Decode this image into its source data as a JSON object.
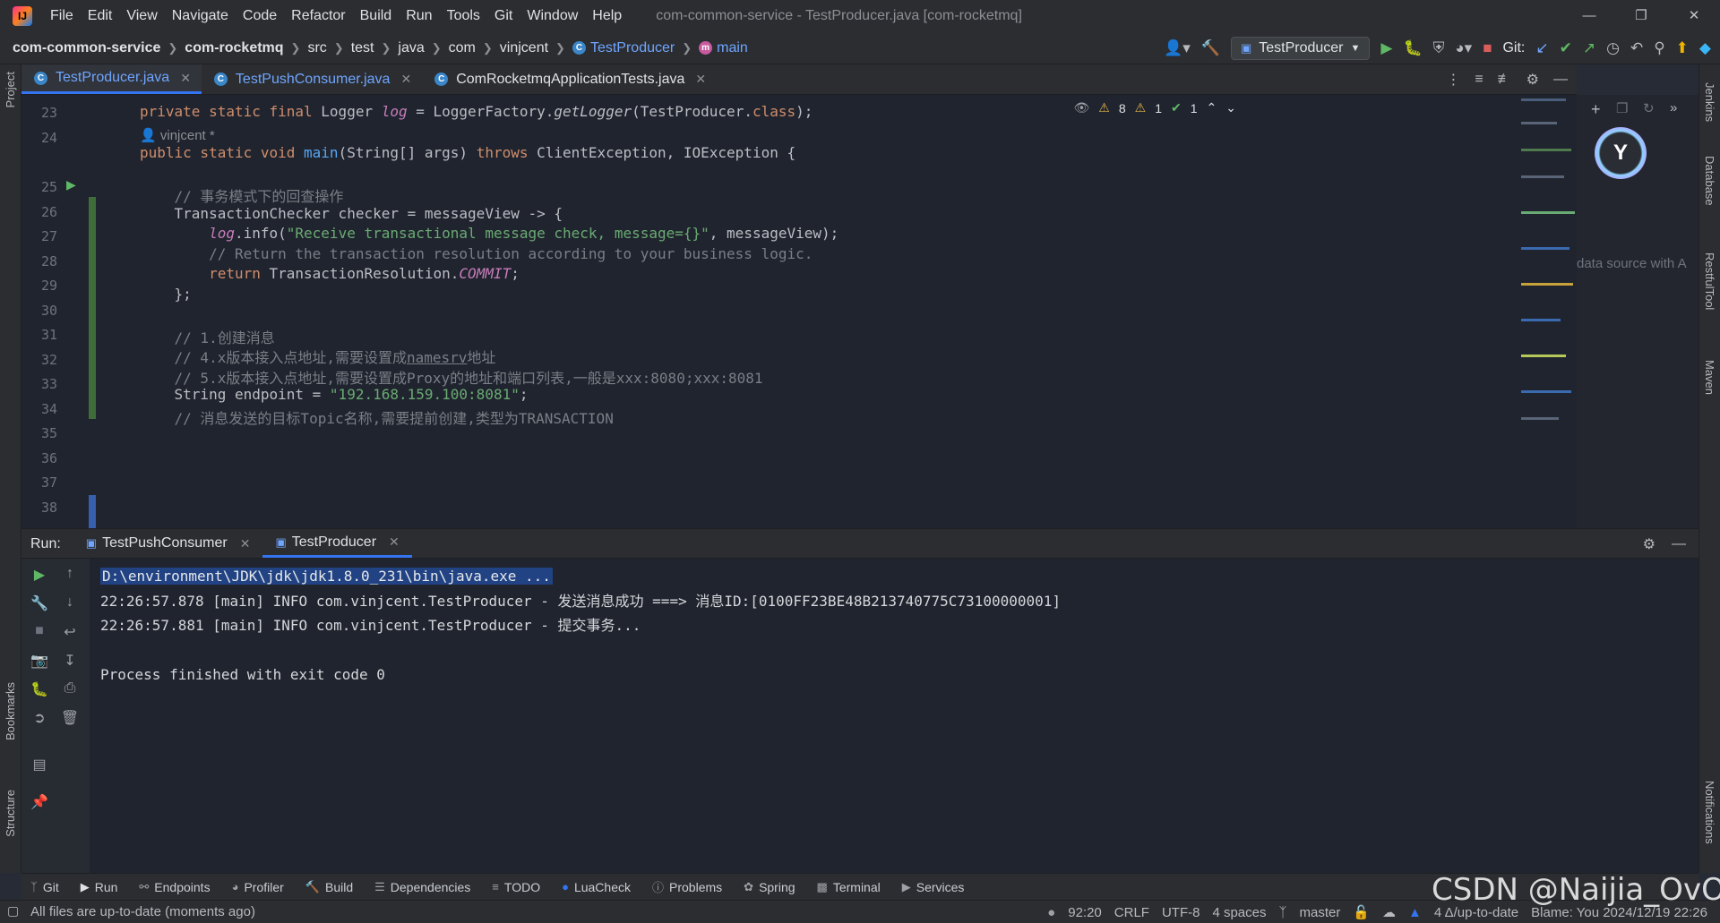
{
  "menubar": {
    "items": [
      "File",
      "Edit",
      "View",
      "Navigate",
      "Code",
      "Refactor",
      "Build",
      "Run",
      "Tools",
      "Git",
      "Window",
      "Help"
    ],
    "title": "com-common-service - TestProducer.java [com-rocketmq]"
  },
  "breadcrumb": {
    "project": "com-common-service",
    "module": "com-rocketmq",
    "parts": [
      "src",
      "test",
      "java",
      "com",
      "vinjcent"
    ],
    "class": "TestProducer",
    "method": "main"
  },
  "toolbar": {
    "run_config": "TestProducer",
    "git_label": "Git:"
  },
  "editor_tabs": [
    {
      "label": "TestProducer.java",
      "active": true
    },
    {
      "label": "TestPushConsumer.java",
      "active": false
    },
    {
      "label": "ComRocketmqApplicationTests.java",
      "active": false
    }
  ],
  "inspections": {
    "warnings": "8",
    "weak_warnings": "1",
    "ok": "1"
  },
  "code": {
    "line_numbers": [
      "23",
      "24",
      "",
      "25",
      "26",
      "27",
      "28",
      "29",
      "30",
      "31",
      "32",
      "33",
      "34",
      "35",
      "36",
      "37",
      "38"
    ],
    "author_hint": "vinjcent *"
  },
  "ai_panel": {
    "hint": "data source with A"
  },
  "run_panel": {
    "label": "Run:",
    "tabs": [
      {
        "label": "TestPushConsumer",
        "active": false
      },
      {
        "label": "TestProducer",
        "active": true
      }
    ],
    "console": [
      "D:\\environment\\JDK\\jdk\\jdk1.8.0_231\\bin\\java.exe ...",
      "22:26:57.878 [main] INFO com.vinjcent.TestProducer - 发送消息成功 ===> 消息ID:[0100FF23BE48B213740775C73100000001]",
      "22:26:57.881 [main] INFO com.vinjcent.TestProducer - 提交事务...",
      "",
      "Process finished with exit code 0"
    ]
  },
  "tool_windows": [
    "Git",
    "Run",
    "Endpoints",
    "Profiler",
    "Build",
    "Dependencies",
    "TODO",
    "LuaCheck",
    "Problems",
    "Spring",
    "Terminal",
    "Services"
  ],
  "left_strip": {
    "project": "Project",
    "bookmarks": "Bookmarks",
    "structure": "Structure"
  },
  "right_strip": {
    "jenkins": "Jenkins",
    "database": "Database",
    "restful": "RestfulTool",
    "maven": "Maven",
    "notifications": "Notifications"
  },
  "status_bar": {
    "message": "All files are up-to-date (moments ago)",
    "position": "92:20",
    "line_sep": "CRLF",
    "encoding": "UTF-8",
    "indent": "4 spaces",
    "branch": "master",
    "vcs_state": "4 Δ/up-to-date",
    "blame": "Blame: You 2024/12/19 22:26"
  },
  "watermark": "CSDN @Naijia_OvO",
  "colors": {
    "accent": "#3574f0",
    "keyword": "#cf8e6d",
    "string": "#6aab73",
    "comment": "#7a7e85",
    "run_green": "#5fb865"
  }
}
